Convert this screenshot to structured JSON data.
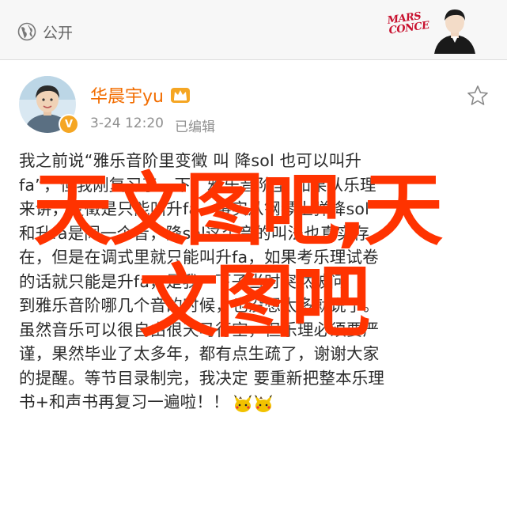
{
  "topbar": {
    "visibility_label": "公开",
    "banner_text_line1": "MARS",
    "banner_text_line2": "CONCERT"
  },
  "post": {
    "username": "华晨宇yu",
    "timestamp": "3-24 12:20",
    "edited_label": "已编辑",
    "avatar_badge": "V",
    "body_lines": [
      "我之前说“雅乐音阶里变徵 叫 降sol 也可以叫升",
      "fa”，但我刚复习了一下，雅乐音阶里 如果从乐理",
      "来讲，变徵是只能叫升fa，事实从钢琴上弹降sol",
      "和升fa是同一个音，降sol这个音的叫法也真实存",
      "在，但是在调式里就只能叫升fa，如果考乐理试卷",
      "的话就只能是升fa，是我一下子当时突然被问",
      "到雅乐音阶哪几个音的时候，也没想太多就说了。",
      "虽然音乐可以很自由很天马行空，但乐理必须要严",
      "谨，果然毕业了太多年，都有点生疏了，谢谢大家",
      "的提醒。等节目录制完，我决定 要重新把整本乐理",
      "书+和声书再复习一遍啦！！"
    ]
  },
  "watermark": {
    "line1": "天文图吧,天",
    "line2": "文图吧"
  },
  "colors": {
    "username": "#f26d00",
    "watermark": "#ff3300",
    "topbar_bg": "#f7f7f7"
  },
  "icons": {
    "visibility": "globe-icon",
    "favorite": "star-icon",
    "crown": "crown-badge-icon",
    "emoji": "pikachu-emoji-icon"
  }
}
